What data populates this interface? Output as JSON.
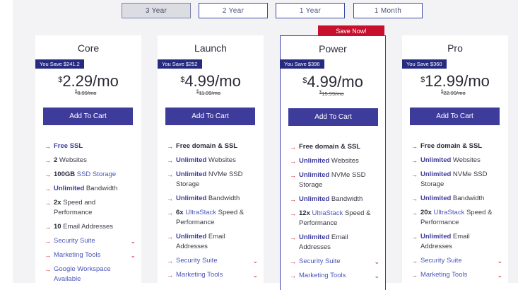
{
  "terms": [
    {
      "label": "3 Year",
      "active": true
    },
    {
      "label": "2 Year",
      "active": false
    },
    {
      "label": "1 Year",
      "active": false
    },
    {
      "label": "1 Month",
      "active": false
    }
  ],
  "featured_ribbon": "Save Now!",
  "cart_label": "Add To Cart",
  "plans": [
    {
      "name": "Core",
      "save": "You Save $241.2",
      "currency": "$",
      "price": "2.29/mo",
      "old_currency": "$",
      "old_price": "8.99/mo",
      "features": [
        {
          "a": "Free SSL",
          "b": ""
        },
        {
          "a": "2",
          "b": " Websites"
        },
        {
          "a": "100GB",
          "b": " SSD Storage"
        },
        {
          "a": "Unlimited",
          "b": " Bandwidth"
        },
        {
          "a": "2x",
          "b": " Speed and Performance"
        },
        {
          "a": "10",
          "b": " Email Addresses"
        },
        {
          "a": "Security Suite",
          "b": ""
        },
        {
          "a": "Marketing Tools",
          "b": ""
        },
        {
          "a": "Google Workspace Available",
          "b": ""
        }
      ]
    },
    {
      "name": "Launch",
      "save": "You Save $252",
      "currency": "$",
      "price": "4.99/mo",
      "old_currency": "$",
      "old_price": "11.99/mo",
      "features": [
        {
          "a": "Free domain & SSL",
          "b": ""
        },
        {
          "a": "Unlimited",
          "b": " Websites"
        },
        {
          "a": "Unlimited",
          "b": " NVMe SSD Storage"
        },
        {
          "a": "Unlimited",
          "b": " Bandwidth"
        },
        {
          "a": "6x",
          "b": " UltraStack",
          "c": " Speed & Performance"
        },
        {
          "a": "Unlimited",
          "b": " Email Addresses"
        },
        {
          "a": "Security Suite",
          "b": ""
        },
        {
          "a": "Marketing Tools",
          "b": ""
        }
      ]
    },
    {
      "name": "Power",
      "save": "You Save $396",
      "currency": "$",
      "price": "4.99/mo",
      "old_currency": "$",
      "old_price": "15.99/mo",
      "features": [
        {
          "a": "Free domain & SSL",
          "b": ""
        },
        {
          "a": "Unlimited",
          "b": " Websites"
        },
        {
          "a": "Unlimited",
          "b": " NVMe SSD Storage"
        },
        {
          "a": "Unlimited",
          "b": " Bandwidth"
        },
        {
          "a": "12x",
          "b": " UltraStack",
          "c": " Speed & Performance"
        },
        {
          "a": "Unlimited",
          "b": " Email Addresses"
        },
        {
          "a": "Security Suite",
          "b": ""
        },
        {
          "a": "Marketing Tools",
          "b": ""
        }
      ]
    },
    {
      "name": "Pro",
      "save": "You Save $360",
      "currency": "$",
      "price": "12.99/mo",
      "old_currency": "$",
      "old_price": "22.99/mo",
      "features": [
        {
          "a": "Free domain & SSL",
          "b": ""
        },
        {
          "a": "Unlimited",
          "b": " Websites"
        },
        {
          "a": "Unlimited",
          "b": " NVMe SSD Storage"
        },
        {
          "a": "Unlimited",
          "b": " Bandwidth"
        },
        {
          "a": "20x",
          "b": " UltraStack",
          "c": " Speed & Performance"
        },
        {
          "a": "Unlimited",
          "b": " Email Addresses"
        },
        {
          "a": "Security Suite",
          "b": ""
        },
        {
          "a": "Marketing Tools",
          "b": ""
        }
      ]
    }
  ],
  "icons": {
    "bullet": "arrow-right-icon",
    "expand": "chevron-down-icon"
  },
  "colors": {
    "accent": "#3e3c9b",
    "badge": "#262b80",
    "red": "#c8102e"
  }
}
